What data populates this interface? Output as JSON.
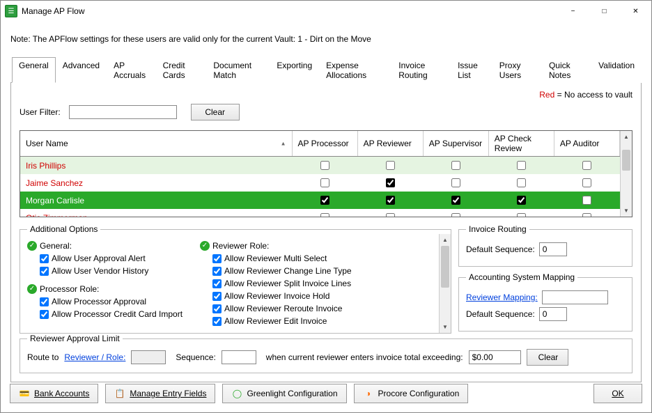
{
  "window": {
    "title": "Manage AP Flow"
  },
  "note": "Note:  The APFlow settings for these users are valid only for the current Vault: 1 - Dirt on the Move",
  "legend": {
    "red_label": "Red",
    "red_desc": "  = No access to vault"
  },
  "tabs": [
    {
      "label": "General"
    },
    {
      "label": "Advanced"
    },
    {
      "label": "AP Accruals"
    },
    {
      "label": "Credit Cards"
    },
    {
      "label": "Document Match"
    },
    {
      "label": "Exporting"
    },
    {
      "label": "Expense Allocations"
    },
    {
      "label": "Invoice Routing"
    },
    {
      "label": "Issue List"
    },
    {
      "label": "Proxy Users"
    },
    {
      "label": "Quick Notes"
    },
    {
      "label": "Validation"
    }
  ],
  "filter": {
    "label": "User Filter:",
    "value": "",
    "clear": "Clear"
  },
  "grid": {
    "columns": [
      "User Name",
      "AP Processor",
      "AP Reviewer",
      "AP Supervisor",
      "AP Check Review",
      "AP Auditor"
    ],
    "rows": [
      {
        "name": "Iris Phillips",
        "red": true,
        "alt": true,
        "sel": false,
        "c": [
          false,
          false,
          false,
          false,
          false
        ]
      },
      {
        "name": "Jaime Sanchez",
        "red": true,
        "alt": false,
        "sel": false,
        "c": [
          false,
          true,
          false,
          false,
          false
        ]
      },
      {
        "name": "Morgan Carlisle",
        "red": false,
        "alt": false,
        "sel": true,
        "c": [
          true,
          true,
          true,
          true,
          false
        ]
      },
      {
        "name": "Otis Zimmerman",
        "red": true,
        "alt": false,
        "sel": false,
        "c": [
          false,
          false,
          false,
          false,
          false
        ]
      }
    ]
  },
  "additional": {
    "legend": "Additional Options",
    "col1": {
      "general_hdr": "General:",
      "general": [
        "Allow User Approval Alert",
        "Allow User Vendor History"
      ],
      "processor_hdr": "Processor Role:",
      "processor": [
        "Allow Processor Approval",
        "Allow Processor Credit Card Import"
      ]
    },
    "col2": {
      "reviewer_hdr": "Reviewer Role:",
      "reviewer": [
        "Allow Reviewer Multi Select",
        "Allow Reviewer Change Line Type",
        "Allow Reviewer Split Invoice Lines",
        "Allow Reviewer Invoice Hold",
        "Allow Reviewer Reroute Invoice",
        "Allow Reviewer Edit Invoice"
      ]
    }
  },
  "invoice_routing": {
    "legend": "Invoice Routing",
    "seq_label": "Default Sequence:",
    "seq_value": "0"
  },
  "acct_mapping": {
    "legend": "Accounting System Mapping",
    "map_label": "Reviewer Mapping:",
    "map_value": "",
    "seq_label": "Default Sequence:",
    "seq_value": "0"
  },
  "rev_limit": {
    "legend": "Reviewer Approval Limit",
    "route_to": "Route to ",
    "link": "Reviewer / Role:",
    "role_value": "",
    "seq_label": "Sequence:",
    "seq_value": "",
    "when_text": "when current reviewer enters invoice total exceeding:",
    "amount": "$0.00",
    "clear": "Clear"
  },
  "footer": {
    "bank": "Bank Accounts",
    "entry": "Manage Entry Fields",
    "green": "Greenlight Configuration",
    "procore": "Procore Configuration",
    "ok": "OK"
  }
}
